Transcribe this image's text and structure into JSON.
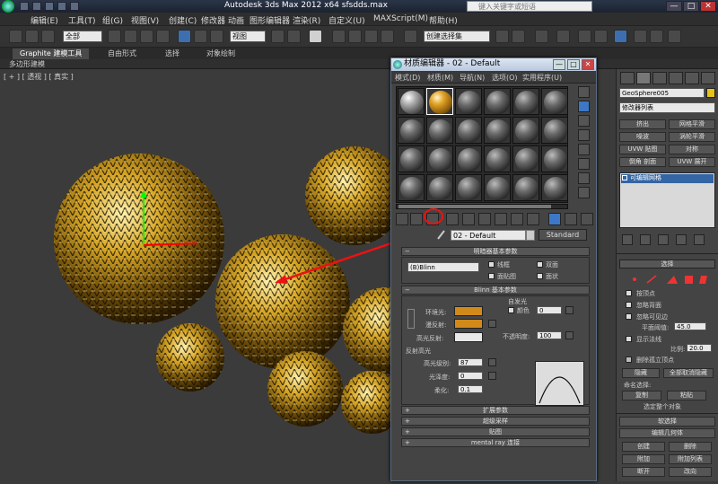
{
  "titlebar": {
    "title": "Autodesk 3ds Max  2012 x64     sfsdds.max",
    "search_placeholder": "键入关键字或短语",
    "min": "—",
    "max": "□",
    "close": "✕"
  },
  "menu": [
    "编辑(E)",
    "工具(T)",
    "组(G)",
    "视图(V)",
    "创建(C)",
    "修改器",
    "动画",
    "图形编辑器",
    "渲染(R)",
    "自定义(U)",
    "MAXScript(M)",
    "帮助(H)"
  ],
  "toolbar": {
    "selection_filter": "全部",
    "ref_coord": "视图",
    "named_sel": "创建选择集"
  },
  "ribbon": {
    "tabs": [
      "Graphite 建模工具",
      "自由形式",
      "选择",
      "对象绘制"
    ],
    "subtab": "多边形建模"
  },
  "viewport": {
    "label": "[ + ] [ 透视 ] [ 真实 ]"
  },
  "material_editor": {
    "title": "材质编辑器 - 02 - Default",
    "menu": [
      "模式(D)",
      "材质(M)",
      "导航(N)",
      "选项(O)",
      "实用程序(U)"
    ],
    "material_name": "02 - Default",
    "material_type": "Standard",
    "shader_rollout": "明暗器基本参数",
    "shader_value": "(B)Blinn",
    "shader_checks": [
      "线框",
      "双面",
      "面贴图",
      "面状"
    ],
    "blinn_rollout": "Blinn 基本参数",
    "self_illum": "自发光",
    "color_label": "颜色",
    "color_value": "0",
    "ambient": "环境光:",
    "diffuse": "漫反射:",
    "specular": "高光反射:",
    "opacity_label": "不透明度:",
    "opacity_value": "100",
    "spec_highlights": "反射高光",
    "spec_level_label": "高光级别:",
    "spec_level_value": "87",
    "gloss_label": "光泽度:",
    "gloss_value": "0",
    "soften_label": "柔化:",
    "soften_value": "0.1",
    "colors": {
      "ambient": "#d18a1a",
      "diffuse": "#d18a1a",
      "specular": "#e8e8e8"
    },
    "collapsed_rollouts": [
      "扩展参数",
      "超级采样",
      "贴图",
      "mental ray 连接"
    ]
  },
  "command_panel": {
    "object_name": "GeoSphere005",
    "object_color": "#e7c319",
    "modifier_list": "修改器列表",
    "buttons": [
      [
        "挤出",
        "网格平滑"
      ],
      [
        "噪波",
        "涡轮平滑"
      ],
      [
        "UVW 贴图",
        "对称"
      ],
      [
        "倒角 剖面",
        "UVW 展开"
      ]
    ],
    "stack_item": "可编辑网格",
    "selection_rollout": "选择",
    "sel_checks": [
      "按顶点",
      "忽略背面",
      "忽略可见边",
      "显示法线",
      "删除孤立顶点"
    ],
    "planar_thresh_label": "平面阈值:",
    "planar_thresh_value": "45.0",
    "scale_label": "比例:",
    "scale_value": "20.0",
    "hide_btn": "隐藏",
    "unhide_all_btn": "全部取消隐藏",
    "named_sel_label": "命名选择:",
    "copy_btn": "复制",
    "paste_btn": "粘贴",
    "selected_info": "选定整个对象",
    "soft_sel": "软选择",
    "edit_geo": "编辑几何体",
    "create_btn": "创建",
    "delete_btn": "删除",
    "attach_btn": "附加",
    "attach_list_btn": "附加列表",
    "detach_btn": "断开",
    "last_btn": "改向"
  }
}
